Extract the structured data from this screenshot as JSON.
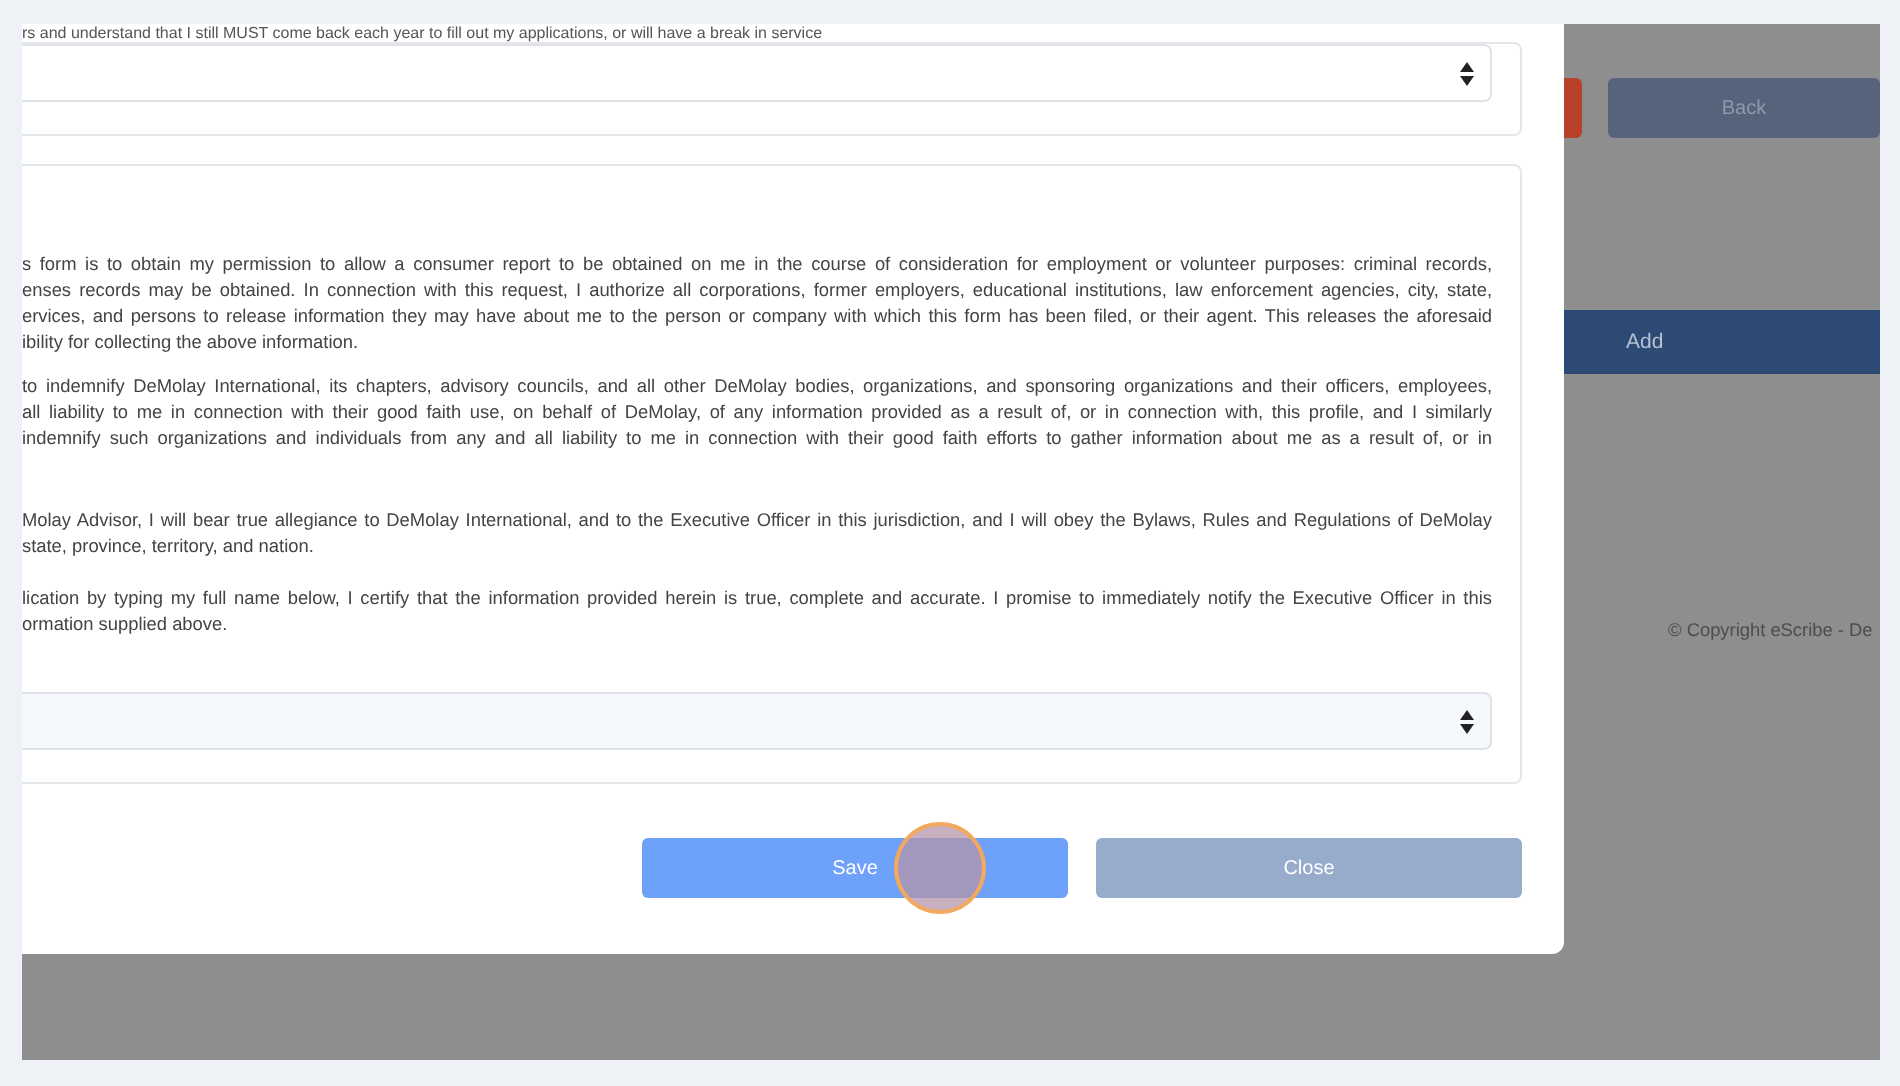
{
  "modal": {
    "intro_line": "rs and understand that I still MUST come back each year to fill out my applications, or will have a break in service",
    "paragraphs": [
      {
        "lines": [
          "s form is to obtain my permission to allow a consumer report to be obtained on me in the course of consideration for employment or volunteer purposes: criminal records,",
          "enses records may be obtained. In connection with this request, I authorize all corporations, former employers, educational institutions, law enforcement agencies, city, state,",
          "ervices, and persons to release information they may have about me to the person or company with which this form has been filed, or their agent. This releases the aforesaid",
          "ibility for collecting the above information."
        ]
      },
      {
        "lines": [
          "to indemnify DeMolay International, its chapters, advisory councils, and all other DeMolay bodies, organizations, and sponsoring organizations and their officers, employees,",
          "all liability to me in connection with their good faith use, on behalf of DeMolay, of any information provided as a result of, or in connection with, this profile, and I similarly",
          "indemnify such organizations and individuals from any and all liability to me in connection with their good faith efforts to gather information about me as a result of, or in"
        ]
      },
      {
        "lines": [
          "Molay Advisor, I will bear true allegiance to DeMolay International, and to the Executive Officer in this jurisdiction, and I will obey the Bylaws, Rules and Regulations of DeMolay",
          "state, province, territory, and nation."
        ]
      },
      {
        "lines": [
          "lication by typing my full name below, I certify that the information provided herein is true, complete and accurate. I promise to immediately notify the Executive Officer in this",
          "ormation supplied above."
        ]
      }
    ],
    "buttons": [
      {
        "label": "Save",
        "kind": "primary"
      },
      {
        "label": "Close",
        "kind": "secondary"
      }
    ]
  },
  "background_page": {
    "back_button": "Back",
    "add_bar": "Add",
    "footer": "© Copyright eScribe - De"
  }
}
